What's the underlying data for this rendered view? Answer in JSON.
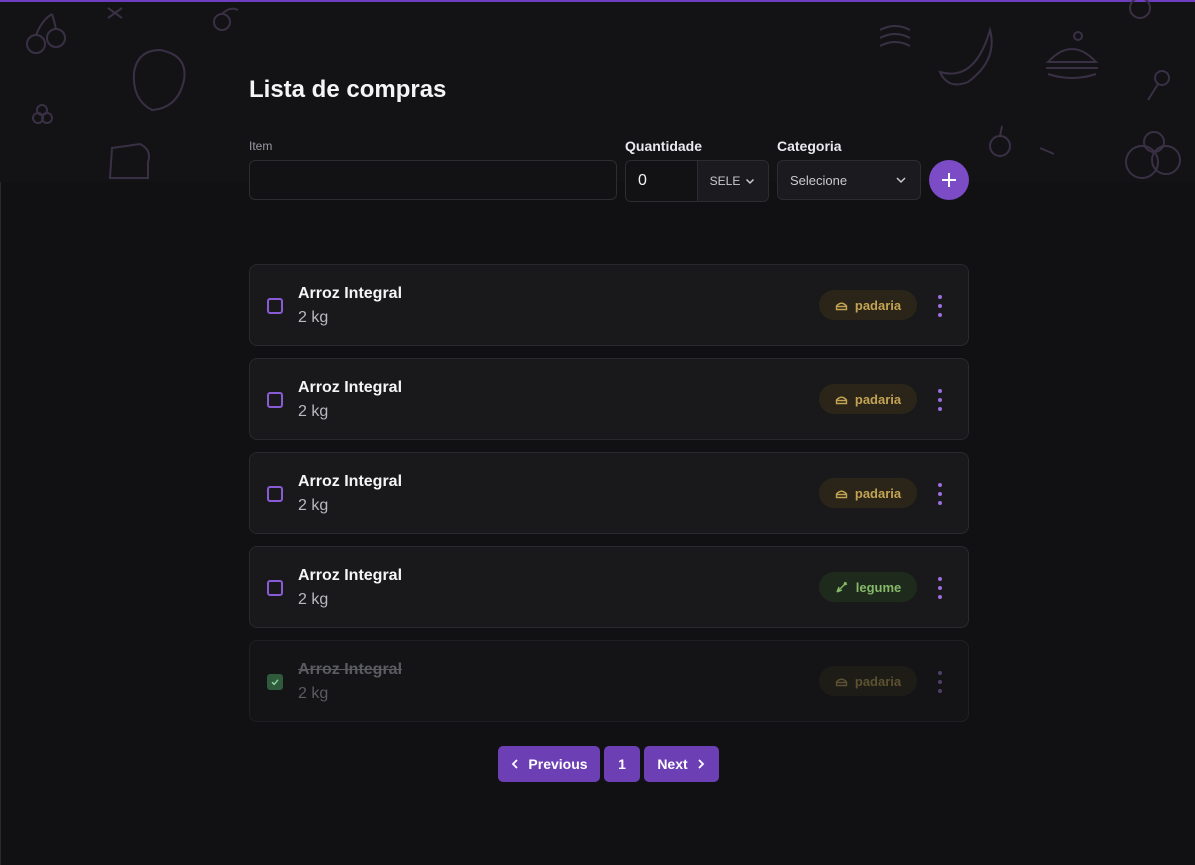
{
  "page": {
    "title": "Lista de compras",
    "accent_color": "#6d3fc0"
  },
  "form": {
    "item_label": "Item",
    "item_value": "",
    "quantity_label": "Quantidade",
    "quantity_value": "0",
    "unit_value": "SELE",
    "category_label": "Categoria",
    "category_value": "Selecione",
    "add_icon": "plus-icon"
  },
  "items": [
    {
      "name": "Arroz Integral",
      "quantity": "2 kg",
      "category": "padaria",
      "category_icon": "bread-icon",
      "checked": false
    },
    {
      "name": "Arroz Integral",
      "quantity": "2 kg",
      "category": "padaria",
      "category_icon": "bread-icon",
      "checked": false
    },
    {
      "name": "Arroz Integral",
      "quantity": "2 kg",
      "category": "padaria",
      "category_icon": "bread-icon",
      "checked": false
    },
    {
      "name": "Arroz Integral",
      "quantity": "2 kg",
      "category": "legume",
      "category_icon": "carrot-icon",
      "checked": false
    },
    {
      "name": "Arroz Integral",
      "quantity": "2 kg",
      "category": "padaria",
      "category_icon": "bread-icon",
      "checked": true
    }
  ],
  "pagination": {
    "previous_label": "Previous",
    "current_page": "1",
    "next_label": "Next"
  },
  "colors": {
    "padaria": "#c3a353",
    "legume": "#86b86a",
    "checkbox": "#8a5bd6",
    "checked": "#2f5a3b"
  }
}
